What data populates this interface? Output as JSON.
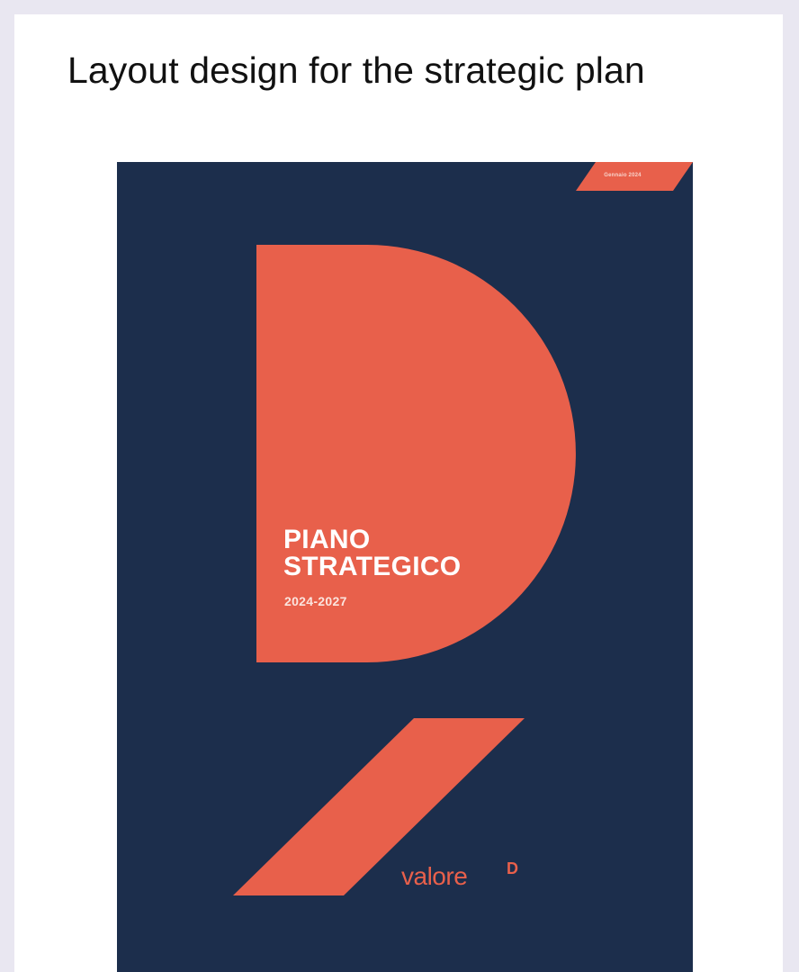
{
  "page": {
    "title": "Layout design for the strategic plan"
  },
  "cover": {
    "date_badge": "Gennaio 2024",
    "title_line1": "PIANO",
    "title_line2": "STRATEGICO",
    "years": "2024-2027",
    "logo_word": "valore",
    "logo_mark": "D"
  },
  "colors": {
    "background": "#e9e7f1",
    "card": "#ffffff",
    "cover_navy": "#1c2e4c",
    "accent_coral": "#e8604b"
  }
}
